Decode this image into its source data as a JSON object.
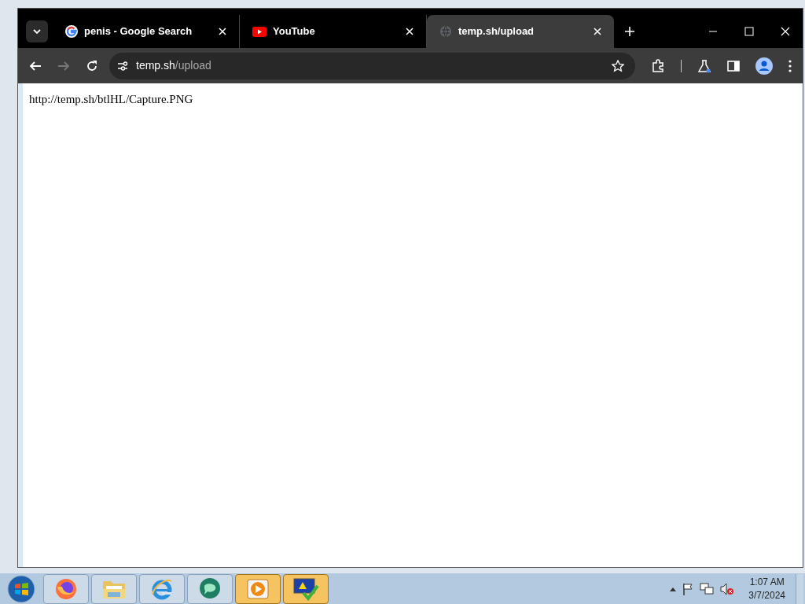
{
  "browser": {
    "tabs": [
      {
        "title": "penis - Google Search",
        "kind": "google",
        "selected": false
      },
      {
        "title": "YouTube",
        "kind": "youtube",
        "selected": false
      },
      {
        "title": "temp.sh/upload",
        "kind": "globe",
        "selected": true
      }
    ],
    "address": {
      "host": "temp.sh",
      "path": "/upload"
    },
    "page_text": "http://temp.sh/btlHL/Capture.PNG"
  },
  "taskbar": {
    "items": [
      {
        "kind": "firefox",
        "active": false
      },
      {
        "kind": "folder",
        "active": false
      },
      {
        "kind": "ie",
        "active": false
      },
      {
        "kind": "chat",
        "active": false
      },
      {
        "kind": "media",
        "active": true
      },
      {
        "kind": "monitor",
        "active": true
      }
    ],
    "clock": {
      "time": "1:07 AM",
      "date": "3/7/2024"
    }
  }
}
